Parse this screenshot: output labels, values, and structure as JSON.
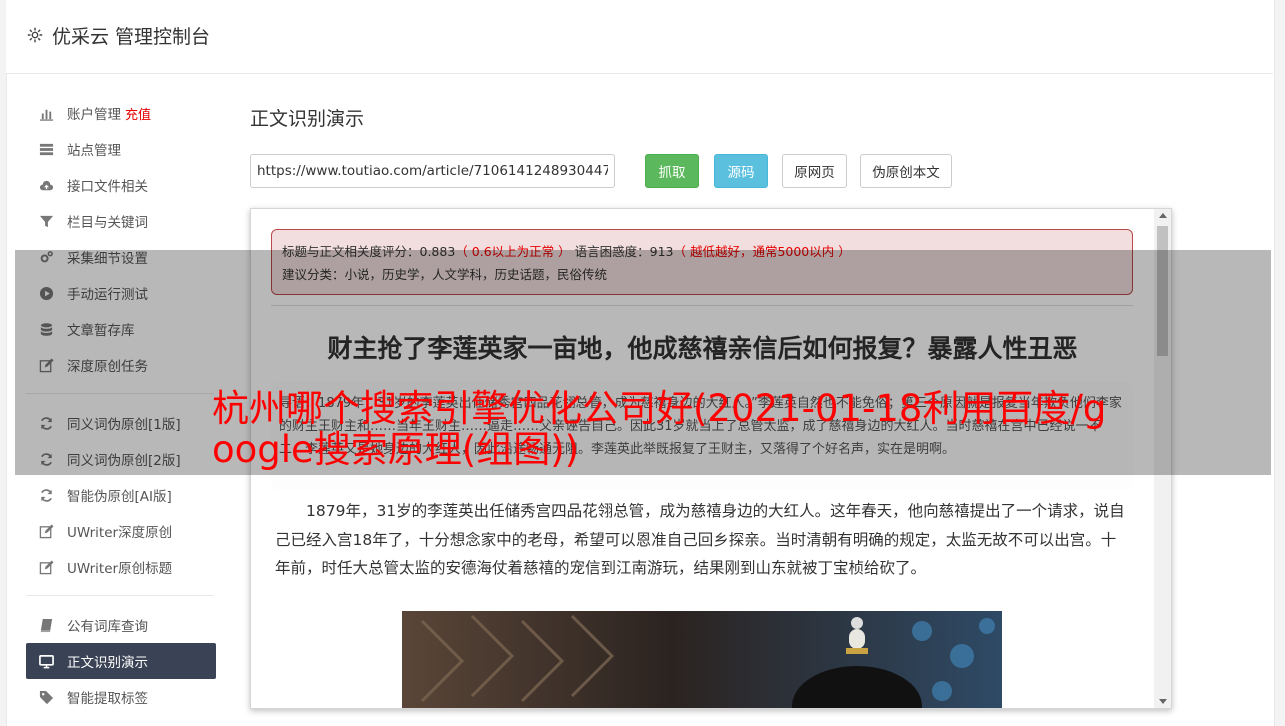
{
  "header": {
    "title": "优采云 管理控制台"
  },
  "sidebar": {
    "group1": [
      {
        "label": "账户管理",
        "extra": "充值",
        "icon": "bar-chart-icon"
      },
      {
        "label": "站点管理",
        "icon": "server-icon"
      },
      {
        "label": "接口文件相关",
        "icon": "cloud-upload-icon"
      },
      {
        "label": "栏目与关键词",
        "icon": "filter-icon"
      },
      {
        "label": "采集细节设置",
        "icon": "cogs-icon"
      },
      {
        "label": "手动运行测试",
        "icon": "play-circle-icon"
      },
      {
        "label": "文章暂存库",
        "icon": "database-icon"
      },
      {
        "label": "深度原创任务",
        "icon": "edit-icon"
      }
    ],
    "group2": [
      {
        "label": "同义词伪原创[1版]",
        "icon": "refresh-icon"
      },
      {
        "label": "同义词伪原创[2版]",
        "icon": "refresh-icon"
      },
      {
        "label": "智能伪原创[AI版]",
        "icon": "refresh-icon"
      },
      {
        "label": "UWriter深度原创",
        "icon": "edit-icon"
      },
      {
        "label": "UWriter原创标题",
        "icon": "edit-icon"
      }
    ],
    "group3": [
      {
        "label": "公有词库查询",
        "icon": "book-icon"
      },
      {
        "label": "正文识别演示",
        "icon": "monitor-icon",
        "active": true
      },
      {
        "label": "智能提取标签",
        "icon": "tag-icon"
      }
    ]
  },
  "main": {
    "title": "正文识别演示",
    "url_value": "https://www.toutiao.com/article/7106141248930447",
    "buttons": {
      "grab": "抓取",
      "source": "源码",
      "original": "原网页",
      "pseudo": "伪原创本文"
    },
    "alert": {
      "relevance_label": "标题与正文相关度评分：0.883",
      "relevance_hint": "（ 0.6以上为正常 ）",
      "perplexity_label": "语言困惑度：913",
      "perplexity_hint": "（ 越低越好，通常5000以内 ）",
      "category": "建议分类：小说，历史学，人文学科，历史话题，民俗传统"
    },
    "article_title": "财主抢了李莲英家一亩地，他成慈禧亲信后如何报复？暴露人性丑恶",
    "quote_text": "导语：1879年，31岁的李莲英出任储秀宫四品花翎总管，成为慈禧身边的大红人。”李莲英自然也不能免俗；第三个原因就是报复当年欺负他们李家的财主王财主和……当年王财主……逼走……父亲诬告自己。因此31岁就当上了总管太监，成了慈禧身边的大红人。当时慈禧在宫中已经说一不二，李莲英又是她身边的大红人，因此沿途畅通无阻。李莲英此举既报复了王财主，又落得了个好名声，实在是明啊。",
    "paragraph": "1879年，31岁的李莲英出任储秀宫四品花翎总管，成为慈禧身边的大红人。这年春天，他向慈禧提出了一个请求，说自己已经入宫18年了，十分想念家中的老母，希望可以恩准自己回乡探亲。当时清朝有明确的规定，太监无故不可以出宫。十年前，时任大总管太监的安德海仗着慈禧的宠信到江南游玩，结果刚到山东就被丁宝桢给砍了。"
  },
  "overlay": {
    "title": "杭州哪个搜索引擎优化公司好(2021-01-18利用百度/google搜索原理(组图))"
  }
}
